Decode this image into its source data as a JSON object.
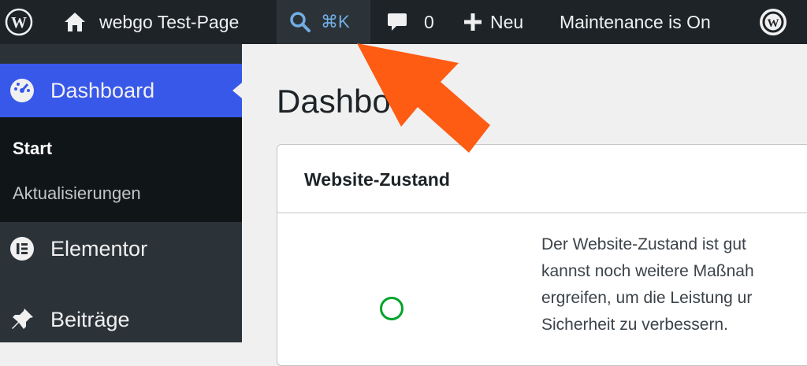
{
  "adminbar": {
    "site_name": "webgo Test-Page",
    "search_shortcut": "⌘K",
    "comments_count": "0",
    "new_label": "Neu",
    "maintenance_label": "Maintenance is On"
  },
  "sidebar": {
    "dashboard_label": "Dashboard",
    "submenu": {
      "start_label": "Start",
      "updates_label": "Aktualisierungen"
    },
    "elementor_label": "Elementor",
    "posts_label": "Beiträge"
  },
  "main": {
    "page_title": "Dashbo",
    "card": {
      "title": "Website-Zustand",
      "lines": [
        "Der Website-Zustand ist gut",
        "kannst noch weitere Maßnah",
        "ergreifen, um die Leistung ur",
        "Sicherheit zu verbessern."
      ]
    }
  },
  "colors": {
    "adminbar_bg": "#1d2327",
    "sidebar_bg": "#2c3338",
    "accent": "#3858e9",
    "arrow": "#fe5b13",
    "status_good": "#00a32a"
  },
  "icons": [
    "wordpress-logo-icon",
    "home-icon",
    "search-icon",
    "comment-icon",
    "plus-icon",
    "dashboard-gauge-icon",
    "elementor-icon",
    "pin-icon",
    "status-circle-icon",
    "pointer-arrow-icon"
  ]
}
